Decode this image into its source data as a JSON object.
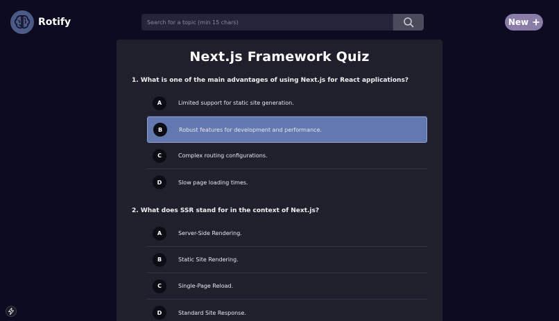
{
  "header": {
    "app_name": "Rotify",
    "search_placeholder": "Search for a topic (min 15 chars)",
    "search_value": "",
    "new_label": "New"
  },
  "quiz": {
    "title": "Next.js Framework Quiz",
    "questions": [
      {
        "text": "1. What is one of the main advantages of using Next.js for React applications?",
        "options": [
          {
            "letter": "A",
            "text": "Limited support for static site generation."
          },
          {
            "letter": "B",
            "text": "Robust features for development and performance.",
            "selected": true
          },
          {
            "letter": "C",
            "text": "Complex routing configurations."
          },
          {
            "letter": "D",
            "text": "Slow page loading times."
          }
        ]
      },
      {
        "text": "2. What does SSR stand for in the context of Next.js?",
        "options": [
          {
            "letter": "A",
            "text": "Server-Side Rendering."
          },
          {
            "letter": "B",
            "text": "Static Site Rendering."
          },
          {
            "letter": "C",
            "text": "Single-Page Reload."
          },
          {
            "letter": "D",
            "text": "Standard Site Response."
          }
        ]
      }
    ]
  },
  "colors": {
    "background": "#0c0b1f",
    "card": "#20202d",
    "selected_option": "#6478b0",
    "new_button": "#8a7ea8"
  },
  "icons": {
    "logo": "brain-icon",
    "search": "search-icon",
    "new": "plus-icon",
    "corner": "lightning-icon"
  }
}
